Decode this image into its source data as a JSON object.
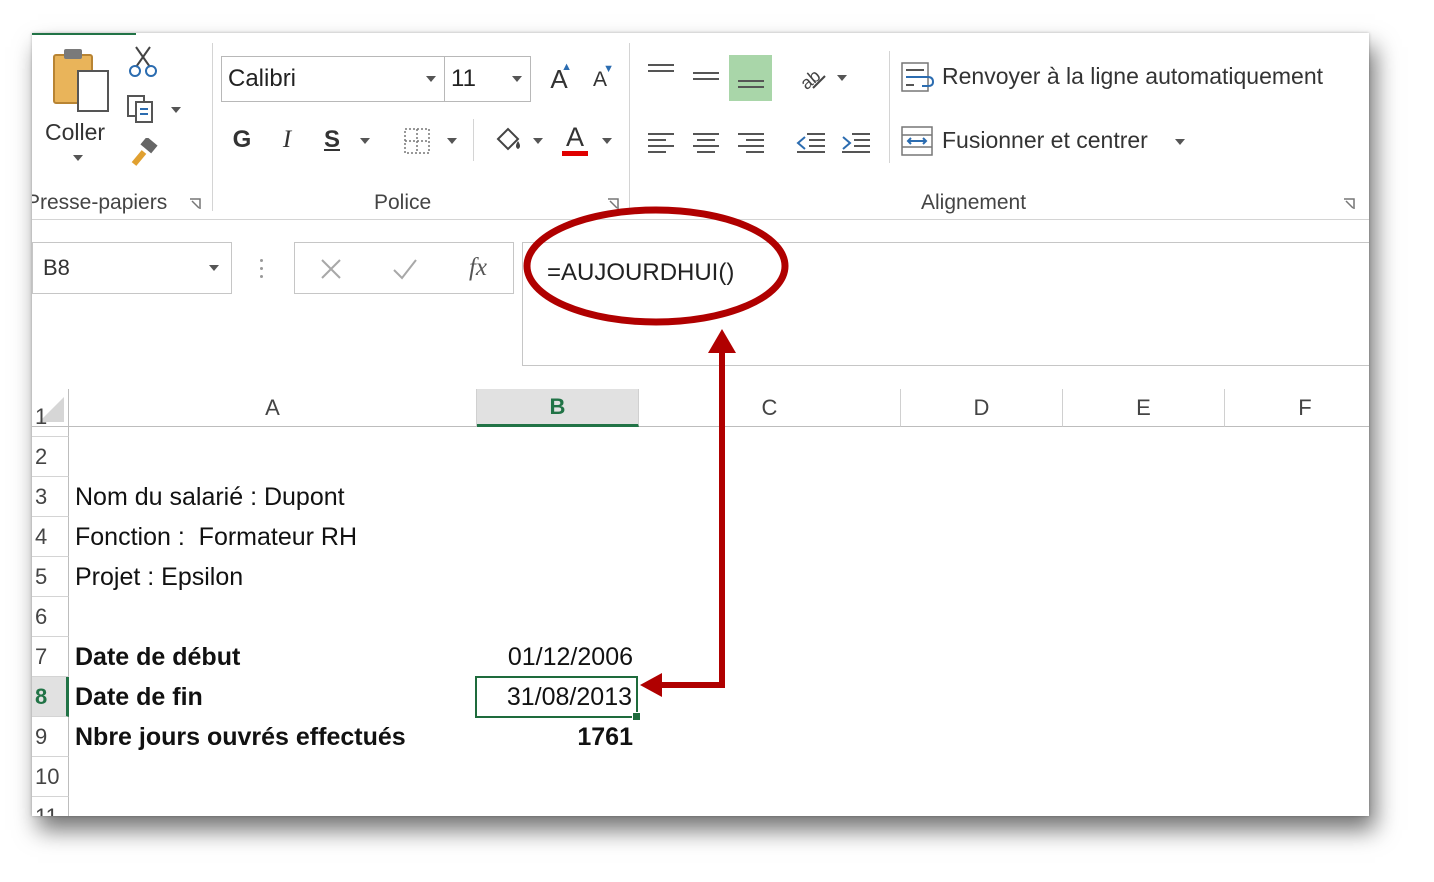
{
  "ribbon": {
    "clipboard": {
      "paste_label": "Coller",
      "group_label": "Presse-papiers"
    },
    "font": {
      "name": "Calibri",
      "size": "11",
      "bold_label": "G",
      "italic_label": "I",
      "underline_label": "S",
      "grow_label": "A",
      "shrink_label": "A",
      "color_label": "A",
      "group_label": "Police"
    },
    "alignment": {
      "wrap_label": "Renvoyer à la ligne automatiquement",
      "merge_label": "Fusionner et centrer",
      "group_label": "Alignement"
    }
  },
  "formula_bar": {
    "name_box": "B8",
    "fx_label": "fx",
    "formula": "=AUJOURDHUI()"
  },
  "sheet": {
    "columns": [
      "A",
      "B",
      "C",
      "D",
      "E",
      "F"
    ],
    "rows": [
      "1",
      "2",
      "3",
      "4",
      "5",
      "6",
      "7",
      "8",
      "9",
      "10",
      "11"
    ],
    "cells": {
      "a3": "Nom du salarié : Dupont",
      "a4": "Fonction :  Formateur RH",
      "a5": "Projet : Epsilon",
      "a7": "Date de début",
      "b7": "01/12/2006",
      "a8": "Date de fin",
      "b8": "31/08/2013",
      "a9": "Nbre jours ouvrés effectués",
      "b9": "1761"
    }
  },
  "colors": {
    "accent_green": "#217346",
    "annotation_red": "#b00000",
    "selected_cell_border": "#1e6b3c"
  }
}
